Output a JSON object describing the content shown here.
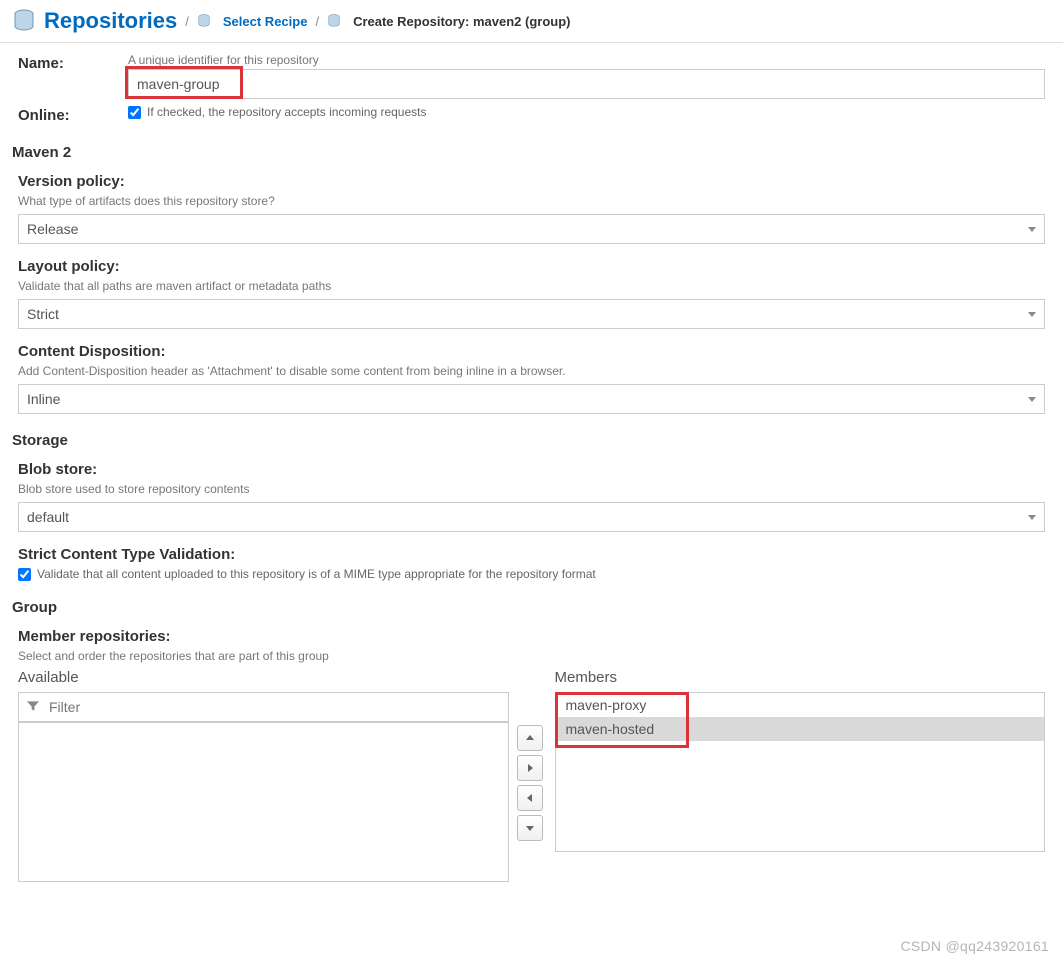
{
  "breadcrumb": {
    "root": "Repositories",
    "step2": "Select Recipe",
    "current": "Create Repository: maven2 (group)"
  },
  "name_section": {
    "label": "Name:",
    "hint": "A unique identifier for this repository",
    "value": "maven-group"
  },
  "online_section": {
    "label": "Online:",
    "checked": true,
    "text": "If checked, the repository accepts incoming requests"
  },
  "maven2": {
    "section": "Maven 2",
    "version_policy": {
      "label": "Version policy:",
      "hint": "What type of artifacts does this repository store?",
      "value": "Release"
    },
    "layout_policy": {
      "label": "Layout policy:",
      "hint": "Validate that all paths are maven artifact or metadata paths",
      "value": "Strict"
    },
    "content_disposition": {
      "label": "Content Disposition:",
      "hint": "Add Content-Disposition header as 'Attachment' to disable some content from being inline in a browser.",
      "value": "Inline"
    }
  },
  "storage": {
    "section": "Storage",
    "blob_store": {
      "label": "Blob store:",
      "hint": "Blob store used to store repository contents",
      "value": "default"
    },
    "strict_validation": {
      "label": "Strict Content Type Validation:",
      "checked": true,
      "text": "Validate that all content uploaded to this repository is of a MIME type appropriate for the repository format"
    }
  },
  "group": {
    "section": "Group",
    "member_repos": {
      "label": "Member repositories:",
      "hint": "Select and order the repositories that are part of this group"
    },
    "available_label": "Available",
    "members_label": "Members",
    "filter_placeholder": "Filter",
    "available": [],
    "members": [
      "maven-proxy",
      "maven-hosted"
    ],
    "selected_member_index": 1
  },
  "watermark": "CSDN @qq243920161"
}
